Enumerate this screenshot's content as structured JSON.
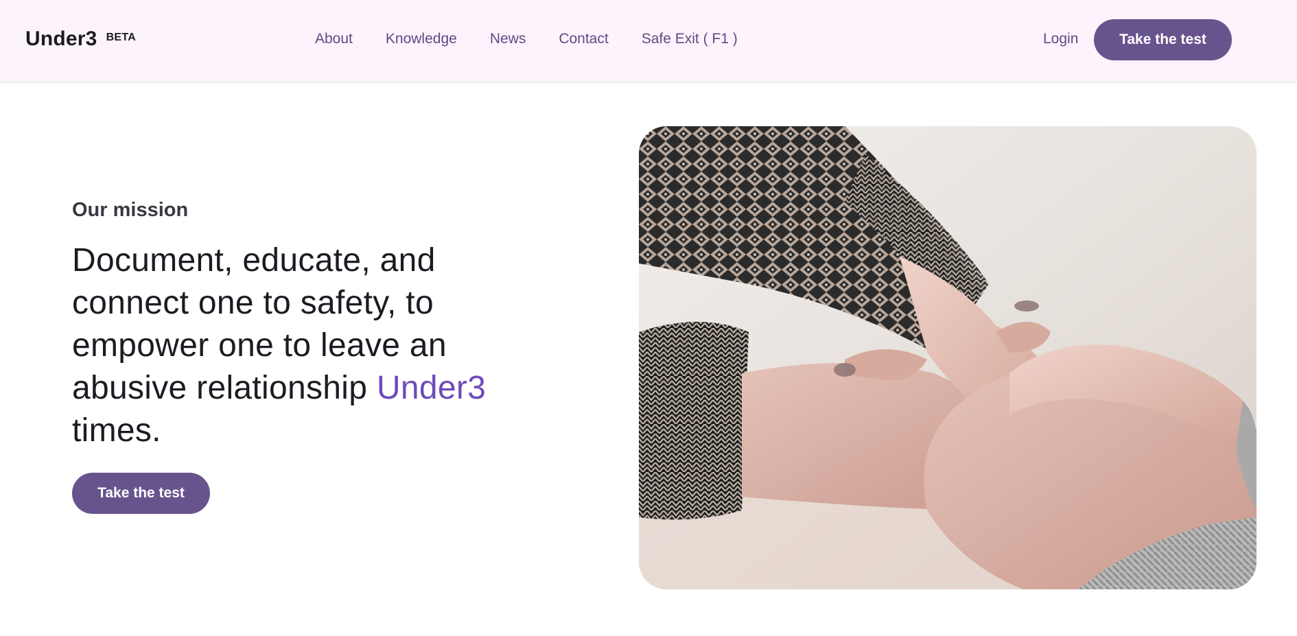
{
  "header": {
    "brand": "Under3",
    "badge": "BETA",
    "nav": [
      {
        "label": "About"
      },
      {
        "label": "Knowledge"
      },
      {
        "label": "News"
      },
      {
        "label": "Contact"
      },
      {
        "label": "Safe Exit ( F1 )"
      }
    ],
    "login_label": "Login",
    "cta_label": "Take the test"
  },
  "hero": {
    "eyebrow": "Our mission",
    "headline_lead": "Document, educate, and connect one to safety, to empower one to leave an abusive relationship ",
    "headline_accent": "Under3",
    "headline_tail": " times.",
    "cta_label": "Take the test",
    "image_icon": "holding-hands-photo"
  },
  "colors": {
    "header_bg": "#fdf3fc",
    "accent": "#6e4aba",
    "button": "#67548d",
    "nav_text": "#5a4b83"
  }
}
